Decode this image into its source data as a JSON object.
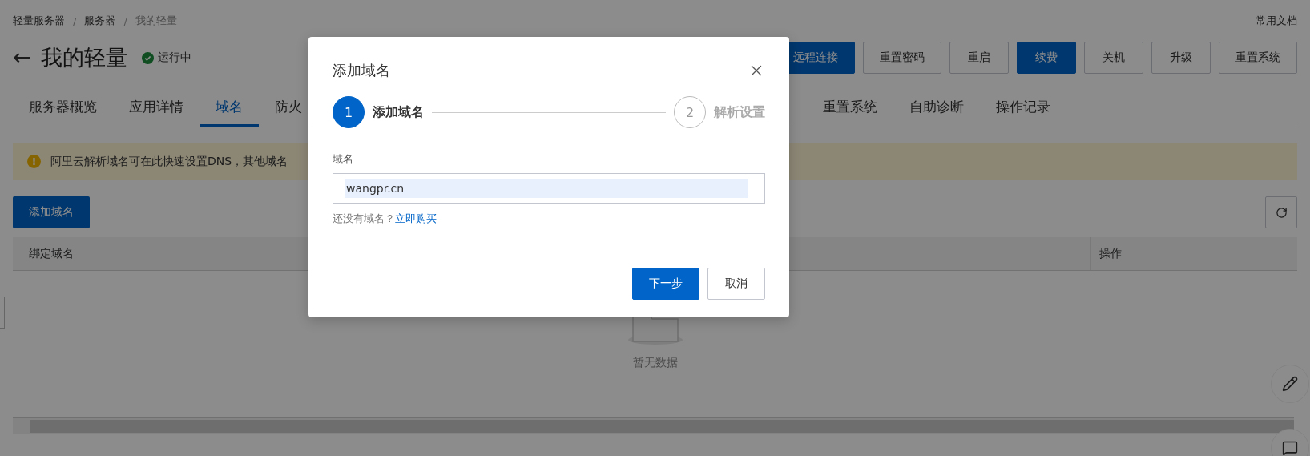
{
  "breadcrumb": [
    {
      "label": "轻量服务器",
      "current": false
    },
    {
      "label": "服务器",
      "current": false
    },
    {
      "label": "我的轻量",
      "current": true
    }
  ],
  "breadcrumb_separator": "/",
  "docs_link": "常用文档",
  "header": {
    "back_icon": "←",
    "title": "我的轻量",
    "status": "运行中"
  },
  "actions": [
    {
      "label": "远程连接",
      "primary": true
    },
    {
      "label": "重置密码",
      "primary": false
    },
    {
      "label": "重启",
      "primary": false
    },
    {
      "label": "续费",
      "primary": true
    },
    {
      "label": "关机",
      "primary": false
    },
    {
      "label": "升级",
      "primary": false
    },
    {
      "label": "重置系统",
      "primary": false
    }
  ],
  "tabs": [
    {
      "label": "服务器概览",
      "selected": false
    },
    {
      "label": "应用详情",
      "selected": false
    },
    {
      "label": "域名",
      "selected": true
    },
    {
      "label": "防火",
      "selected": false
    },
    {
      "label": "重置系统",
      "selected": false
    },
    {
      "label": "自助诊断",
      "selected": false
    },
    {
      "label": "操作记录",
      "selected": false
    }
  ],
  "alert": {
    "icon": "!",
    "text": "阿里云解析域名可在此快速设置DNS，其他域名"
  },
  "add_button": "添加域名",
  "table": {
    "columns": [
      "绑定域名",
      "操作"
    ],
    "empty_text": "暂无数据"
  },
  "dialog": {
    "title": "添加域名",
    "steps": [
      {
        "number": "1",
        "label": "添加域名",
        "selected": true
      },
      {
        "number": "2",
        "label": "解析设置",
        "selected": false
      }
    ],
    "field": {
      "label": "域名",
      "value": "wangpr.cn",
      "autofilled": true
    },
    "hint": "还没有域名？",
    "link": "立即购买",
    "buttons": [
      {
        "label": "下一步",
        "primary": true
      },
      {
        "label": "取消",
        "primary": false
      }
    ]
  }
}
